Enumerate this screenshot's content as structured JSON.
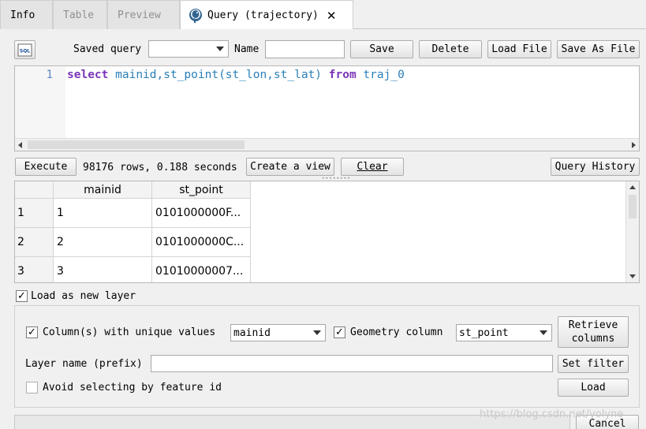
{
  "tabs": [
    {
      "label": "Info"
    },
    {
      "label": "Table"
    },
    {
      "label": "Preview"
    },
    {
      "label": "Query (trajectory)"
    }
  ],
  "toolbar": {
    "saved_query_label": "Saved query",
    "saved_query_value": "",
    "name_label": "Name",
    "name_value": "",
    "save_label": "Save",
    "delete_label": "Delete",
    "load_file_label": "Load File",
    "save_as_file_label": "Save As File"
  },
  "editor": {
    "line_number": "1",
    "tokens": {
      "kw1": "select",
      "cols": "mainid,st_point(st_lon,st_lat)",
      "kw2": "from",
      "table": "traj_0"
    }
  },
  "actions": {
    "execute_label": "Execute",
    "status": "98176 rows, 0.188 seconds",
    "create_view_label": "Create a view",
    "clear_label": "Clear",
    "history_label": "Query History"
  },
  "results": {
    "columns": [
      "mainid",
      "st_point"
    ],
    "rows": [
      {
        "num": "1",
        "mainid": "1",
        "st_point": "0101000000F..."
      },
      {
        "num": "2",
        "mainid": "2",
        "st_point": "0101000000C..."
      },
      {
        "num": "3",
        "mainid": "3",
        "st_point": "01010000007..."
      }
    ]
  },
  "layer": {
    "load_as_new_layer_label": "Load as new layer",
    "load_as_new_layer_checked": true,
    "unique_values_label": "Column(s) with unique values",
    "unique_values_checked": true,
    "unique_values_select": "mainid",
    "geometry_column_label": "Geometry column",
    "geometry_column_checked": true,
    "geometry_column_select": "st_point",
    "retrieve_columns_line1": "Retrieve",
    "retrieve_columns_line2": "columns",
    "layer_name_label": "Layer name (prefix)",
    "layer_name_value": "",
    "set_filter_label": "Set filter",
    "avoid_selecting_label": "Avoid selecting by feature id",
    "avoid_selecting_checked": false,
    "load_label": "Load",
    "cancel_label": "Cancel"
  },
  "watermark": "https://blog.csdn.net/yolyne",
  "colors": {
    "keyword": "#7a35b8",
    "identifier": "#2a7fb8",
    "line_number": "#5f87c9"
  }
}
